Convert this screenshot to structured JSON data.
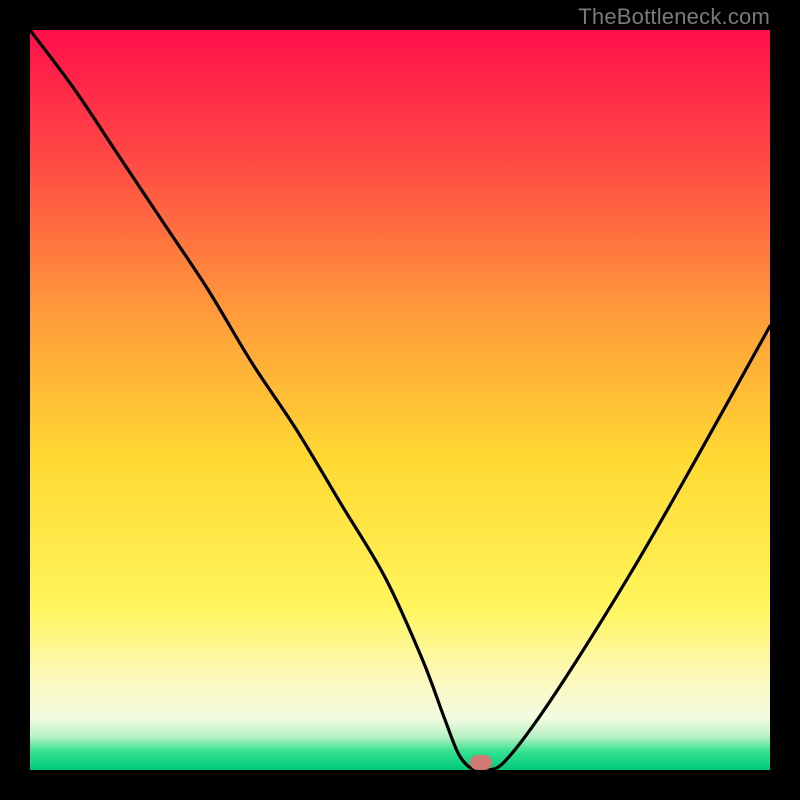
{
  "attribution": "TheBottleneck.com",
  "colors": {
    "top": "#ff0f4a",
    "mid_red_orange": "#ff6a40",
    "mid_orange": "#ffa637",
    "mid_yellow": "#ffe634",
    "pale_yellow": "#fcf7ae",
    "white_band": "#f8fbe6",
    "green": "#1fe08a",
    "deep_green": "#00c97a",
    "frame": "#000000",
    "curve": "#000000",
    "marker": "#cf7a74"
  },
  "chart_data": {
    "type": "line",
    "title": "",
    "xlabel": "",
    "ylabel": "",
    "xlim": [
      0,
      100
    ],
    "ylim": [
      0,
      100
    ],
    "series": [
      {
        "name": "bottleneck-curve",
        "x": [
          0,
          6,
          12,
          18,
          24,
          30,
          36,
          42,
          48,
          53,
          56,
          58,
          60,
          62,
          64,
          68,
          74,
          82,
          90,
          100
        ],
        "values": [
          100,
          92,
          83,
          74,
          65,
          55,
          46,
          36,
          26,
          15,
          7,
          2,
          0,
          0,
          1,
          6,
          15,
          28,
          42,
          60
        ]
      }
    ],
    "optimum_marker": {
      "x": 61,
      "width": 3,
      "height": 2
    },
    "gradient_stops": [
      {
        "pos": 0.0,
        "color": "#ff0f4a"
      },
      {
        "pos": 0.18,
        "color": "#ff4b44"
      },
      {
        "pos": 0.38,
        "color": "#ff9a3a"
      },
      {
        "pos": 0.58,
        "color": "#ffd932"
      },
      {
        "pos": 0.78,
        "color": "#fff55c"
      },
      {
        "pos": 0.88,
        "color": "#fcf9c0"
      },
      {
        "pos": 0.93,
        "color": "#f2fbe0"
      },
      {
        "pos": 0.955,
        "color": "#b8f2c5"
      },
      {
        "pos": 0.975,
        "color": "#34e28f"
      },
      {
        "pos": 1.0,
        "color": "#00c97a"
      }
    ]
  }
}
